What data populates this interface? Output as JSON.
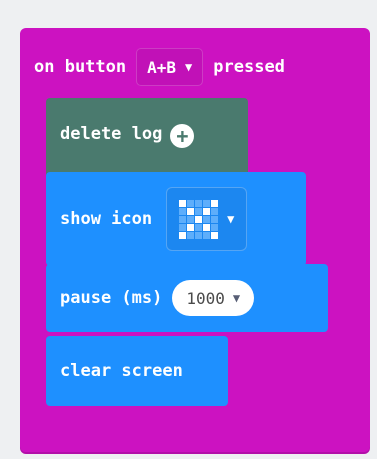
{
  "event": {
    "prefix": "on button",
    "button_value": "A+B",
    "suffix": "pressed"
  },
  "blocks": {
    "delete_log": {
      "label": "delete log"
    },
    "show_icon": {
      "label": "show icon",
      "icon": "diamond-x-pattern"
    },
    "pause": {
      "label": "pause (ms)",
      "value": "1000"
    },
    "clear_screen": {
      "label": "clear screen"
    }
  },
  "colors": {
    "event_block": "#cc12c1",
    "log_block": "#4a7a6e",
    "basic_block": "#1e90ff",
    "background": "#eef0f2"
  }
}
